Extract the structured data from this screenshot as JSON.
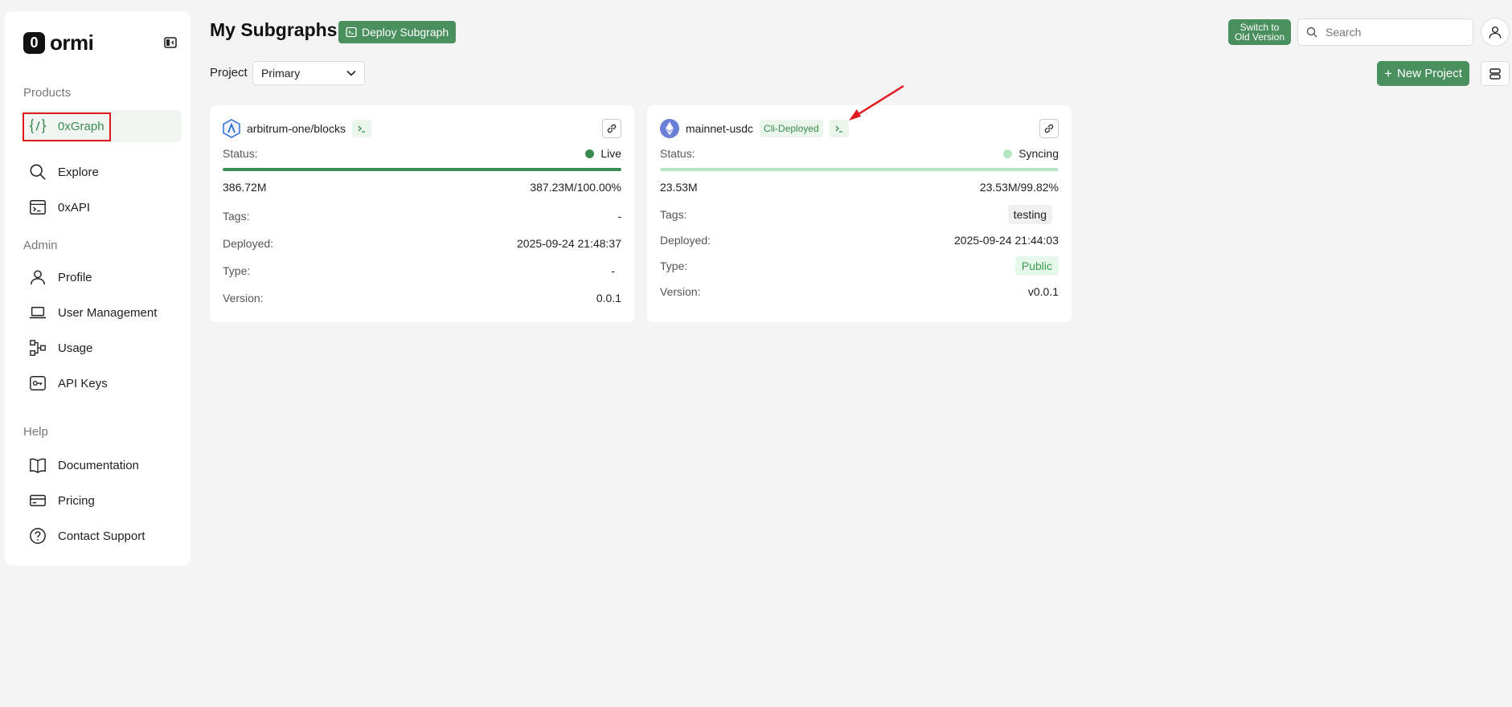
{
  "sidebar": {
    "logo_letter": "0",
    "logo_text": "ormi",
    "sections": {
      "products": "Products",
      "admin": "Admin",
      "help": "Help"
    },
    "items": {
      "oxgraph": "0xGraph",
      "explore": "Explore",
      "oxapi": "0xAPI",
      "profile": "Profile",
      "user_management": "User Management",
      "usage": "Usage",
      "api_keys": "API Keys",
      "documentation": "Documentation",
      "pricing": "Pricing",
      "contact_support": "Contact Support"
    },
    "active_item": "0xGraph"
  },
  "header": {
    "title": "My Subgraphs",
    "deploy_label": "Deploy Subgraph",
    "switch_line1": "Switch to",
    "switch_line2": "Old Version",
    "search_placeholder": "Search"
  },
  "toolbar": {
    "project_label": "Project",
    "project_value": "Primary",
    "new_project_label": "New Project"
  },
  "cards": [
    {
      "name": "arbitrum-one/blocks",
      "status_label": "Status:",
      "status": "Live",
      "status_color": "#3b8a50",
      "progress": 1.0,
      "synced": "386.72M",
      "total": "387.23M/100.00%",
      "tags_label": "Tags:",
      "tags": "-",
      "deployed_label": "Deployed:",
      "deployed": "2025-09-24 21:48:37",
      "type_label": "Type:",
      "type": "-",
      "version_label": "Version:",
      "version": "0.0.1"
    },
    {
      "name": "mainnet-usdc",
      "badge": "Cli-Deployed",
      "status_label": "Status:",
      "status": "Syncing",
      "status_color": "#b5e6c4",
      "progress": 0.9982,
      "synced": "23.53M",
      "total": "23.53M/99.82%",
      "tags_label": "Tags:",
      "tags": "testing",
      "deployed_label": "Deployed:",
      "deployed": "2025-09-24 21:44:03",
      "type_label": "Type:",
      "type": "Public",
      "version_label": "Version:",
      "version": "v0.0.1"
    }
  ],
  "colors": {
    "accent": "#4a8f5e",
    "annotation": "#e0191e"
  }
}
